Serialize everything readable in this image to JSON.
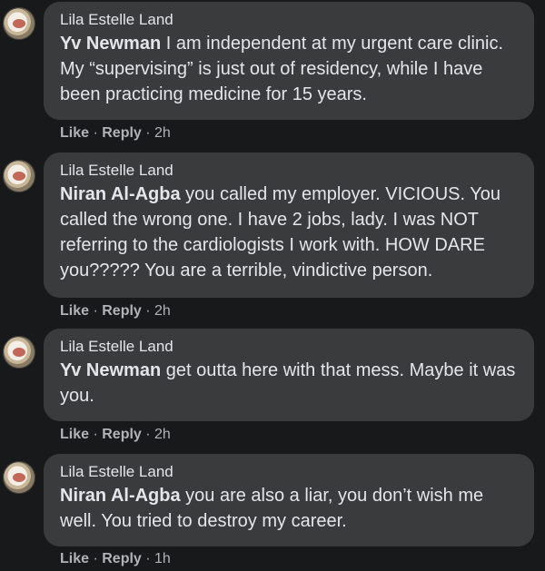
{
  "comments": [
    {
      "author": "Lila Estelle Land",
      "mention": "Yv Newman",
      "text": " I am independent at my urgent care clinic. My “supervising” is just out of residency, while I have been practicing medicine for 15 years.",
      "like": "Like",
      "reply": "Reply",
      "time": "2h"
    },
    {
      "author": "Lila Estelle Land",
      "mention": "Niran Al-Agba",
      "text": " you called my employer. VICIOUS. You called the wrong one. I have 2 jobs, lady. I was NOT referring to the cardiologists I work with. HOW DARE you????? You are a terrible, vindictive person.",
      "like": "Like",
      "reply": "Reply",
      "time": "2h"
    },
    {
      "author": "Lila Estelle Land",
      "mention": "Yv Newman",
      "text": " get outta here with that mess. Maybe it was you.",
      "like": "Like",
      "reply": "Reply",
      "time": "2h"
    },
    {
      "author": "Lila Estelle Land",
      "mention": "Niran Al-Agba",
      "text": " you are also a liar, you don’t wish me well. You tried to destroy my career.",
      "like": "Like",
      "reply": "Reply",
      "time": "1h"
    }
  ],
  "meta_separator": " · "
}
